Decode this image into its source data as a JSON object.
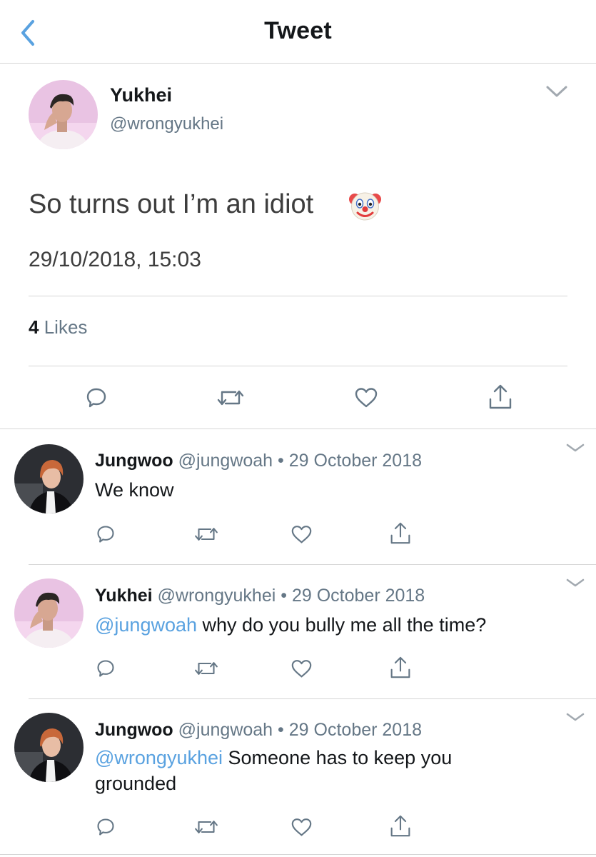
{
  "header": {
    "title": "Tweet",
    "back_icon": "chevron-left-icon"
  },
  "main_tweet": {
    "display_name": "Yukhei",
    "handle": "@wrongyukhei",
    "text": "So turns out I’m an idiot",
    "emoji": "🤡",
    "timestamp": "29/10/2018, 15:03",
    "likes_count": "4",
    "likes_label": "Likes",
    "actions": [
      "reply-icon",
      "retweet-icon",
      "like-icon",
      "share-icon"
    ]
  },
  "replies": [
    {
      "display_name": "Jungwoo",
      "handle": "@jungwoah",
      "separator": "•",
      "date": "29 October 2018",
      "mention": "",
      "text": "We know"
    },
    {
      "display_name": "Yukhei",
      "handle": "@wrongyukhei",
      "separator": "•",
      "date": "29 October 2018",
      "mention": "@jungwoah",
      "text": "why do you bully me all the time?"
    },
    {
      "display_name": "Jungwoo",
      "handle": "@jungwoah",
      "separator": "•",
      "date": "29 October 2018",
      "mention": "@wrongyukhei",
      "text": "Someone has to keep you",
      "text_line2": "grounded"
    }
  ],
  "colors": {
    "accent": "#5aa2e0",
    "secondary_text": "#657786",
    "divider": "#d6d6d6"
  }
}
